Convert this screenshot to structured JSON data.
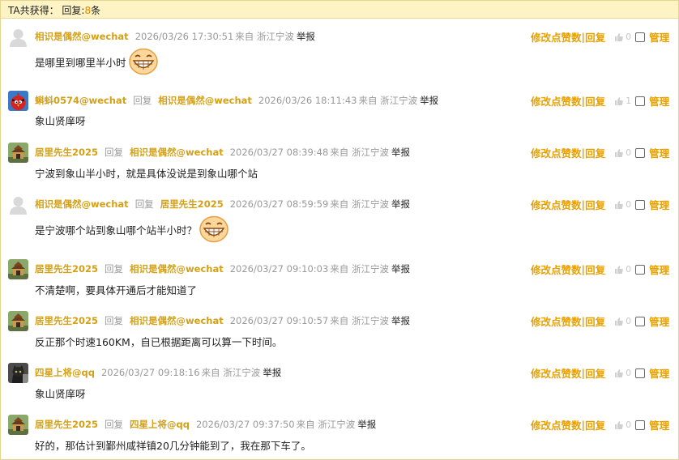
{
  "summary": {
    "prefix": "TA共获得：  回复:",
    "count": "8",
    "suffix": "条"
  },
  "actions": {
    "edit": "修改点赞数",
    "sep": "|",
    "reply": "回复",
    "manage": "管理"
  },
  "entries": [
    {
      "user": "相识是偶然@wechat",
      "reply_word": "",
      "reply_to": "",
      "time": "2026/03/26 17:30:51",
      "source": "来自 浙江宁波",
      "report": "举报",
      "text": "是哪里到哪里半小时",
      "likes": "0",
      "avatar": "default",
      "emoji": "grin-emoji"
    },
    {
      "user": "蝌蚪0574@wechat",
      "reply_word": "回复",
      "reply_to": "相识是偶然@wechat",
      "time": "2026/03/26 18:11:43",
      "source": "来自 浙江宁波",
      "report": "举报",
      "text": "象山贤庠呀",
      "likes": "1",
      "avatar": "bird",
      "emoji": ""
    },
    {
      "user": "居里先生2025",
      "reply_word": "回复",
      "reply_to": "相识是偶然@wechat",
      "time": "2026/03/27 08:39:48",
      "source": "来自 浙江宁波",
      "report": "举报",
      "text": "宁波到象山半小时，就是具体没说是到象山哪个站",
      "likes": "0",
      "avatar": "temple",
      "emoji": ""
    },
    {
      "user": "相识是偶然@wechat",
      "reply_word": "回复",
      "reply_to": "居里先生2025",
      "time": "2026/03/27 08:59:59",
      "source": "来自 浙江宁波",
      "report": "举报",
      "text": "是宁波哪个站到象山哪个站半小时？",
      "likes": "0",
      "avatar": "default",
      "emoji": "grin-emoji"
    },
    {
      "user": "居里先生2025",
      "reply_word": "回复",
      "reply_to": "相识是偶然@wechat",
      "time": "2026/03/27 09:10:03",
      "source": "来自 浙江宁波",
      "report": "举报",
      "text": "不清楚啊，要具体开通后才能知道了",
      "likes": "0",
      "avatar": "temple",
      "emoji": ""
    },
    {
      "user": "居里先生2025",
      "reply_word": "回复",
      "reply_to": "相识是偶然@wechat",
      "time": "2026/03/27 09:10:57",
      "source": "来自 浙江宁波",
      "report": "举报",
      "text": "反正那个时速160KM，自已根据距离可以算一下时间。",
      "likes": "0",
      "avatar": "temple",
      "emoji": ""
    },
    {
      "user": "四星上将@qq",
      "reply_word": "",
      "reply_to": "",
      "time": "2026/03/27 09:18:16",
      "source": "来自 浙江宁波",
      "report": "举报",
      "text": "象山贤庠呀",
      "likes": "0",
      "avatar": "cat",
      "emoji": ""
    },
    {
      "user": "居里先生2025",
      "reply_word": "回复",
      "reply_to": "四星上将@qq",
      "time": "2026/03/27 09:37:50",
      "source": "来自 浙江宁波",
      "report": "举报",
      "text": "好的，那估计到鄞州咸祥镇20几分钟能到了，我在那下车了。",
      "likes": "0",
      "avatar": "temple",
      "emoji": ""
    }
  ]
}
